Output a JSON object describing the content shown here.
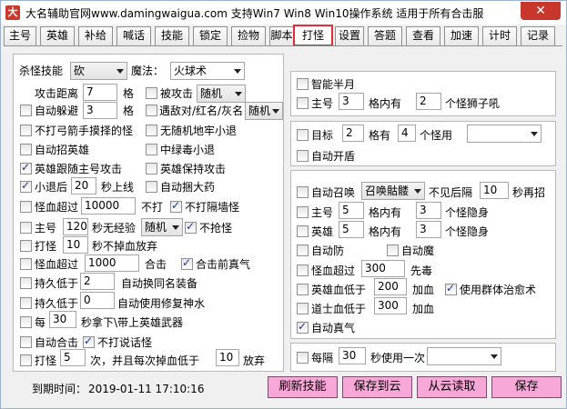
{
  "window": {
    "title": "大名辅助官网www.damingwaigua.com 支持Win7 Win8 Win10操作系统 适用于所有合击服",
    "close_glyph": "✕",
    "icon_glyph": "大"
  },
  "tabs": [
    "主号",
    "英雄",
    "补给",
    "喊话",
    "技能",
    "锁定",
    "捡物",
    "脚本",
    "打怪",
    "设置",
    "答题",
    "查看",
    "加速",
    "计时",
    "记录"
  ],
  "active_tab": "打怪",
  "left": {
    "kill_skill_label": "杀怪技能",
    "kill_skill_value": "砍",
    "magic_label": "魔法：",
    "magic_value": "火球术",
    "attack_range_label": "攻击距离",
    "attack_range_value": "7",
    "grid": "格",
    "hit_back_label": "被攻击",
    "hit_back_value": "随机",
    "auto_dodge_label": "自动躲避",
    "auto_dodge_value": "3",
    "meet_label": "遇敌对/红名/灰名",
    "meet_value": "随机",
    "no_bow_label": "不打弓箭手摸择的怪",
    "no_jail_label": "无随机地牢小退",
    "auto_hero_label": "自动招英雄",
    "mid_poison_label": "中绿毒小退",
    "hero_follow_label": "英雄跟随主号攻击",
    "hero_keep_label": "英雄保持攻击",
    "small_back_label": "小退后",
    "small_back_value": "20",
    "online_label": "秒上线",
    "auto_amulet_label": "自动捆大药",
    "monster_over_label": "怪血超过",
    "monster_over_value": "10000",
    "no_hit_label": "不打",
    "no_wall_label": "不打隔墙怪",
    "main_label": "主号",
    "main_value": "120",
    "no_exp_label": "秒无经验",
    "no_exp_value": "随机",
    "no_grab_label": "不抢怪",
    "fight_label": "打怪",
    "fight_value": "10",
    "no_drop_label": "秒不掉血放弃",
    "monster_over2_label": "怪血超过",
    "monster_over2_value": "1000",
    "hit_combo_label": "合击",
    "combo_front_label": "合击前真气",
    "dur_low_label": "持久低于",
    "dur_low_value": "2",
    "auto_swap_label": "自动换同名装备",
    "dur_low2_label": "持久低于",
    "dur_low2_value": "0",
    "auto_repair_label": "自动使用修复神水",
    "every_label": "每",
    "every_value": "30",
    "every_text": "秒拿下\\带上英雄武器",
    "auto_combo_label": "自动合击",
    "no_talk_label": "不打说话怪",
    "fight2_label": "打怪",
    "fight2_value": "5",
    "fight2_text": "次，并且每次掉血低于",
    "fight2_value2": "10",
    "giveup_label": "放弃"
  },
  "right_top": {
    "smart_label": "智能半月",
    "main_label": "主号",
    "main_value": "3",
    "in_grid_label": "格内有",
    "count_value": "2",
    "lion_label": "个怪狮子吼"
  },
  "right_mid": {
    "target_label": "目标",
    "target_value": "2",
    "has_grid_label": "格有",
    "count_value": "4",
    "use_label": "个怪用",
    "use_value": "",
    "auto_shield_label": "自动开盾"
  },
  "right_bottom": {
    "auto_summon_label": "自动召唤",
    "summon_value": "召唤骷髅",
    "not_see_label": "不见后隔",
    "not_see_value": "10",
    "resummon_label": "秒再招",
    "main_label": "主号",
    "main_value": "5",
    "main_in_label": "格内有",
    "main_count": "3",
    "main_hide_label": "个怪隐身",
    "hero_label": "英雄",
    "hero_value": "5",
    "hero_in_label": "格内有",
    "hero_count": "3",
    "hero_hide_label": "个怪隐身",
    "auto_def_label": "自动防",
    "auto_magic_label": "自动魔",
    "monster_blood_label": "怪血超过",
    "monster_blood_value": "300",
    "poison_label": "先毒",
    "hero_blood_label": "英雄血低于",
    "hero_blood_value": "200",
    "heal_label": "加血",
    "group_heal_label": "使用群体治愈术",
    "taoist_blood_label": "道士血低于",
    "taoist_blood_value": "300",
    "heal2_label": "加血",
    "auto_qi_label": "自动真气"
  },
  "right_last": {
    "every_label": "每隔",
    "every_value": "30",
    "once_label": "秒使用一次",
    "once_value": ""
  },
  "bottom": {
    "expire_label": "到期时间：",
    "expire_value": "2019-01-11 17:10:16",
    "refresh_label": "刷新技能",
    "save_cloud_label": "保存到云",
    "read_cloud_label": "从云读取",
    "save_label": "保存"
  }
}
